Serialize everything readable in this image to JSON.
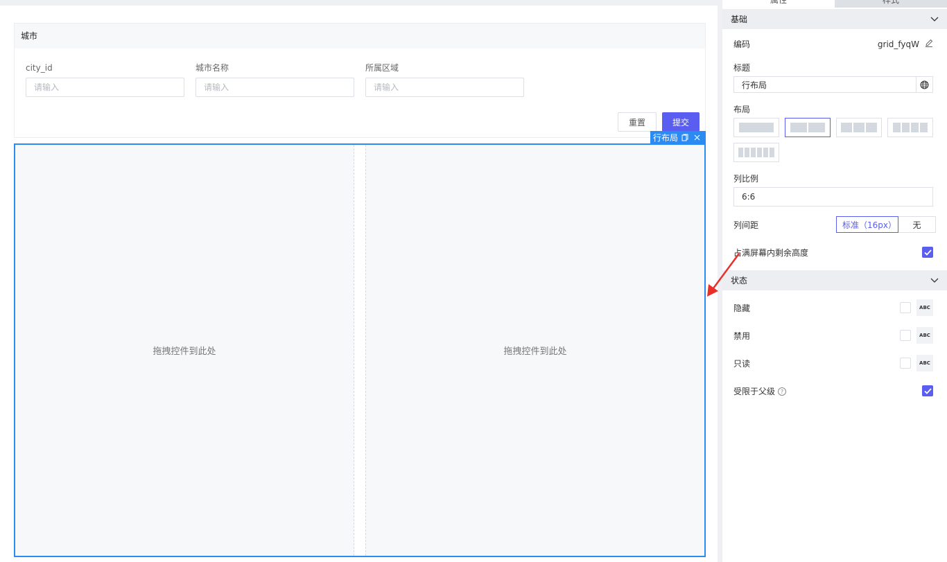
{
  "form": {
    "title": "城市",
    "fields": [
      {
        "label": "city_id",
        "placeholder": "请输入"
      },
      {
        "label": "城市名称",
        "placeholder": "请输入"
      },
      {
        "label": "所属区域",
        "placeholder": "请输入"
      }
    ],
    "reset_label": "重置",
    "submit_label": "提交"
  },
  "grid": {
    "tag_label": "行布局",
    "columns": [
      {
        "placeholder": "拖拽控件到此处"
      },
      {
        "placeholder": "拖拽控件到此处"
      }
    ]
  },
  "panel": {
    "tabs": [
      "属性",
      "样式"
    ],
    "basic": {
      "section_title": "基础",
      "code_label": "编码",
      "code_value": "grid_fyqW",
      "title_label": "标题",
      "title_value": "行布局",
      "layout_label": "布局",
      "layout_options": [
        1,
        2,
        3,
        4,
        6
      ],
      "layout_selected": 2,
      "ratio_label": "列比例",
      "ratio_value": "6:6",
      "gap_label": "列间距",
      "gap_options": [
        "标准（16px）",
        "无"
      ],
      "gap_selected": "标准（16px）",
      "fill_label": "占满屏幕内剩余高度",
      "fill_checked": true
    },
    "state": {
      "section_title": "状态",
      "items": [
        {
          "label": "隐藏",
          "checked": false,
          "abc": "ABC"
        },
        {
          "label": "禁用",
          "checked": false,
          "abc": "ABC"
        },
        {
          "label": "只读",
          "checked": false,
          "abc": "ABC"
        }
      ],
      "limit_label": "受限于父级",
      "limit_checked": true
    }
  },
  "colors": {
    "primary": "#5a5ef0",
    "selection": "#2b8bf2",
    "annotation": "#e8302a"
  }
}
